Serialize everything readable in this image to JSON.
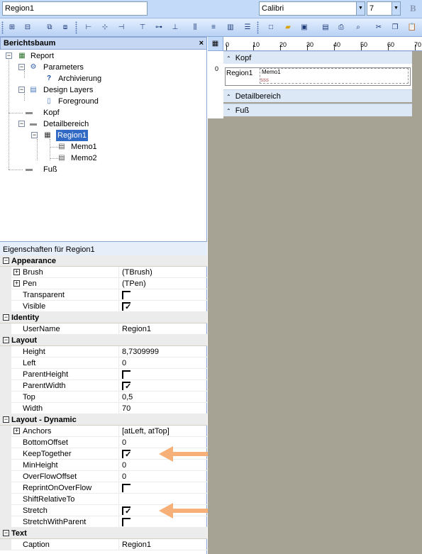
{
  "topbar": {
    "region_combo": "Region1",
    "font_combo": "Calibri",
    "size_combo": "7",
    "bold_label": "B"
  },
  "tree": {
    "title": "Berichtsbaum",
    "close": "×",
    "nodes": {
      "report": "Report",
      "parameters": "Parameters",
      "archivierung": "Archivierung",
      "design_layers": "Design Layers",
      "foreground": "Foreground",
      "kopf": "Kopf",
      "detailbereich": "Detailbereich",
      "region1": "Region1",
      "memo1": "Memo1",
      "memo2": "Memo2",
      "fuss": "Fuß"
    }
  },
  "properties": {
    "title": "Eigenschaften für Region1",
    "categories": {
      "appearance": "Appearance",
      "identity": "Identity",
      "layout": "Layout",
      "layout_dynamic": "Layout - Dynamic",
      "text": "Text"
    },
    "rows": {
      "brush": {
        "name": "Brush",
        "value": "(TBrush)"
      },
      "pen": {
        "name": "Pen",
        "value": "(TPen)"
      },
      "transparent": {
        "name": "Transparent",
        "checked": false
      },
      "visible": {
        "name": "Visible",
        "checked": true
      },
      "username": {
        "name": "UserName",
        "value": "Region1"
      },
      "height": {
        "name": "Height",
        "value": "8,7309999"
      },
      "left": {
        "name": "Left",
        "value": "0"
      },
      "parentheight": {
        "name": "ParentHeight",
        "checked": false
      },
      "parentwidth": {
        "name": "ParentWidth",
        "checked": true
      },
      "top": {
        "name": "Top",
        "value": "0,5"
      },
      "width": {
        "name": "Width",
        "value": "70"
      },
      "anchors": {
        "name": "Anchors",
        "value": "[atLeft, atTop]"
      },
      "bottomoffset": {
        "name": "BottomOffset",
        "value": "0"
      },
      "keeptogether": {
        "name": "KeepTogether",
        "checked": true
      },
      "minheight": {
        "name": "MinHeight",
        "value": "0"
      },
      "overflowoffset": {
        "name": "OverFlowOffset",
        "value": "0"
      },
      "reprintonoverflow": {
        "name": "ReprintOnOverFlow",
        "checked": false
      },
      "shiftrelativeto": {
        "name": "ShiftRelativeTo",
        "value": ""
      },
      "stretch": {
        "name": "Stretch",
        "checked": true
      },
      "stretchwithparent": {
        "name": "StretchWithParent",
        "checked": false
      },
      "caption": {
        "name": "Caption",
        "value": "Region1"
      }
    }
  },
  "designer": {
    "ruler_labels": [
      "0",
      "10",
      "20",
      "30",
      "40",
      "50",
      "60",
      "70"
    ],
    "vruler_label": "0",
    "bands": {
      "kopf": "Kopf",
      "detailbereich": "Detailbereich",
      "fuss": "Fuß"
    },
    "region_label": "Region1",
    "memo_label": "Memo1",
    "memo2_label": "sss"
  },
  "colors": {
    "accent": "#316ac5",
    "arrow": "#f6b078",
    "designer_bg": "#a6a294"
  }
}
